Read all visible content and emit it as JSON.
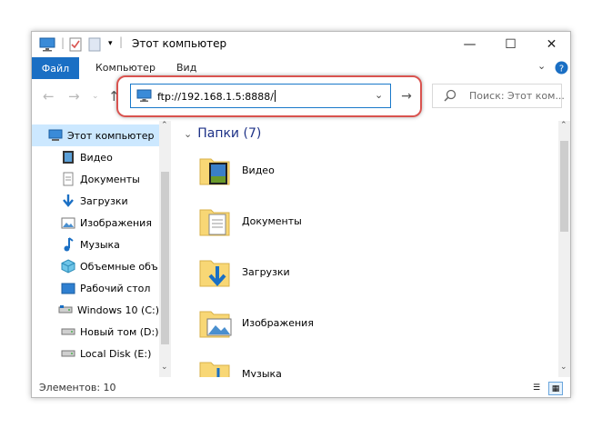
{
  "window": {
    "title": "Этот компьютер",
    "minimize_glyph": "—",
    "maximize_glyph": "☐",
    "close_glyph": "✕"
  },
  "ribbon": {
    "tabs": [
      "Файл",
      "Компьютер",
      "Вид"
    ],
    "expand_icon": "chevron-down-icon",
    "help_icon": "help-icon"
  },
  "address": {
    "value": "ftp://192.168.1.5:8888/",
    "go_icon": "arrow-right-icon"
  },
  "search": {
    "placeholder": "Поиск: Этот ком..."
  },
  "sidebar": {
    "items": [
      {
        "label": "Этот компьютер",
        "icon": "computer-icon",
        "selected": true
      },
      {
        "label": "Видео",
        "icon": "video-icon"
      },
      {
        "label": "Документы",
        "icon": "documents-icon"
      },
      {
        "label": "Загрузки",
        "icon": "downloads-icon"
      },
      {
        "label": "Изображения",
        "icon": "pictures-icon"
      },
      {
        "label": "Музыка",
        "icon": "music-icon"
      },
      {
        "label": "Объемные объ",
        "icon": "3d-objects-icon"
      },
      {
        "label": "Рабочий стол",
        "icon": "desktop-icon"
      },
      {
        "label": "Windows 10 (C:)",
        "icon": "drive-icon"
      },
      {
        "label": "Новый том (D:)",
        "icon": "drive-icon"
      },
      {
        "label": "Local Disk (E:)",
        "icon": "drive-icon"
      }
    ]
  },
  "main": {
    "group_title": "Папки (7)",
    "folders": [
      {
        "label": "Видео",
        "icon": "video-folder-icon"
      },
      {
        "label": "Документы",
        "icon": "documents-folder-icon"
      },
      {
        "label": "Загрузки",
        "icon": "downloads-folder-icon"
      },
      {
        "label": "Изображения",
        "icon": "pictures-folder-icon"
      },
      {
        "label": "Музыка",
        "icon": "music-folder-icon"
      }
    ]
  },
  "status": {
    "text": "Элементов: 10"
  },
  "colors": {
    "accent": "#1a6fc4",
    "highlight_ring": "#d9534f",
    "selection": "#cce8ff",
    "folder_yellow": "#f8d775"
  }
}
